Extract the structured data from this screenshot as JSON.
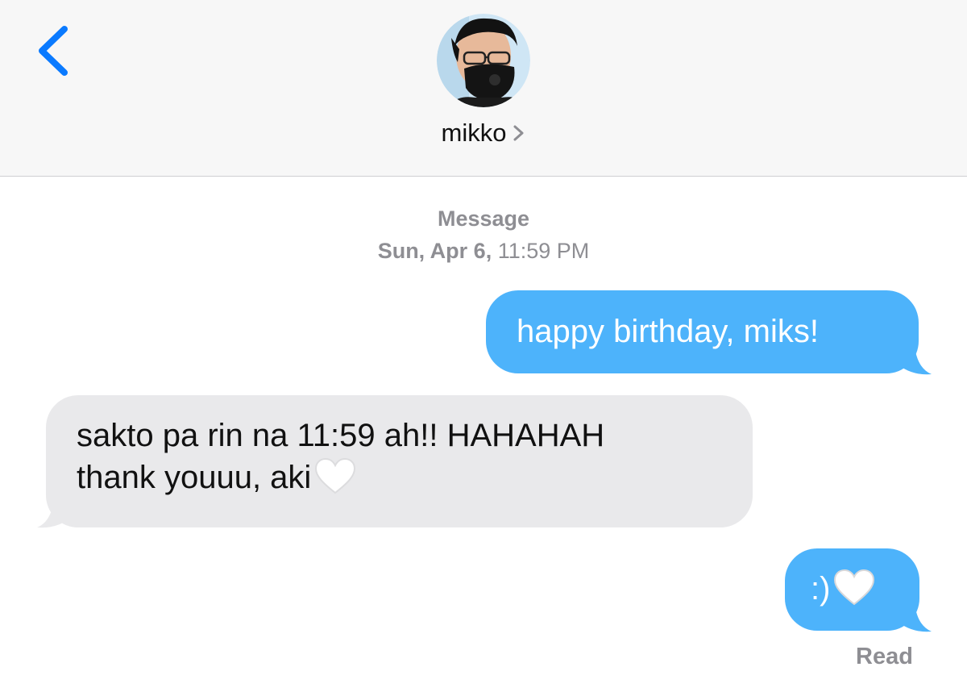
{
  "header": {
    "contact_name": "mikko",
    "colors": {
      "background": "#f7f7f7",
      "accent": "#0a7aff"
    }
  },
  "conversation": {
    "service_label": "Message",
    "date_bold": "Sun, Apr 6,",
    "time": "11:59 PM"
  },
  "messages": [
    {
      "direction": "outgoing",
      "text": "happy birthday, miks!"
    },
    {
      "direction": "incoming",
      "line1": "sakto pa rin na 11:59 ah!! HAHAHAH",
      "line2": "thank youuu, aki",
      "emoji": "white-heart"
    },
    {
      "direction": "outgoing",
      "text": ":)",
      "emoji": "white-heart"
    }
  ],
  "status": {
    "read": "Read"
  },
  "colors": {
    "outgoing_bubble": "#4db3fb",
    "incoming_bubble": "#e9e9eb",
    "meta_text": "#8e8e93"
  }
}
